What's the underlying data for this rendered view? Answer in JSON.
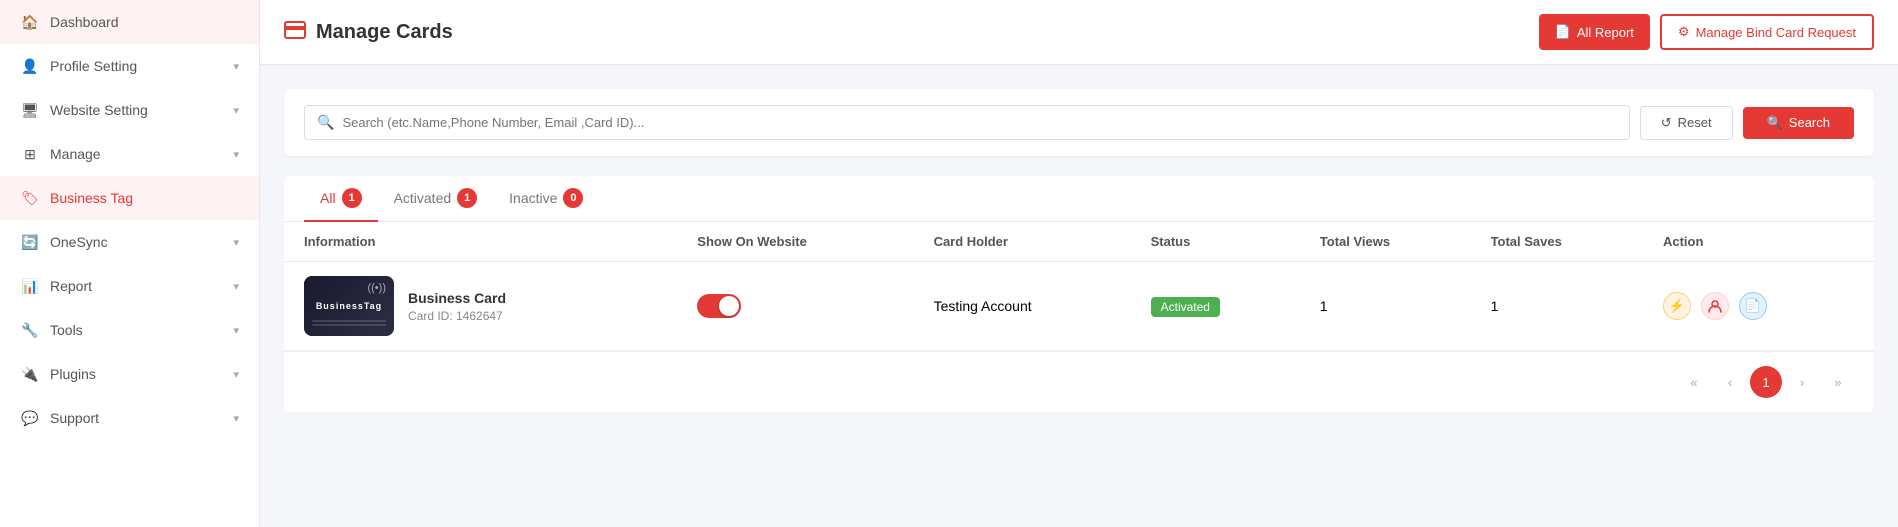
{
  "sidebar": {
    "items": [
      {
        "id": "dashboard",
        "label": "Dashboard",
        "icon": "🏠",
        "hasChevron": false,
        "active": false
      },
      {
        "id": "profile-setting",
        "label": "Profile Setting",
        "icon": "👤",
        "hasChevron": true,
        "active": false
      },
      {
        "id": "website-setting",
        "label": "Website Setting",
        "icon": "🖥",
        "hasChevron": true,
        "active": false
      },
      {
        "id": "manage",
        "label": "Manage",
        "icon": "⊞",
        "hasChevron": true,
        "active": false
      },
      {
        "id": "business-tag",
        "label": "Business Tag",
        "icon": "🏷",
        "hasChevron": false,
        "active": true
      },
      {
        "id": "onesync",
        "label": "OneSync",
        "icon": "🔄",
        "hasChevron": true,
        "active": false
      },
      {
        "id": "report",
        "label": "Report",
        "icon": "📊",
        "hasChevron": true,
        "active": false
      },
      {
        "id": "tools",
        "label": "Tools",
        "icon": "🔧",
        "hasChevron": true,
        "active": false
      },
      {
        "id": "plugins",
        "label": "Plugins",
        "icon": "🔌",
        "hasChevron": true,
        "active": false
      },
      {
        "id": "support",
        "label": "Support",
        "icon": "💬",
        "hasChevron": true,
        "active": false
      }
    ]
  },
  "header": {
    "title": "Manage Cards",
    "title_icon": "🪪",
    "btn_all_report": "All Report",
    "btn_manage_bind": "Manage Bind Card Request"
  },
  "search": {
    "placeholder": "Search (etc.Name,Phone Number, Email ,Card ID)...",
    "reset_label": "Reset",
    "search_label": "Search"
  },
  "tabs": [
    {
      "id": "all",
      "label": "All",
      "count": "1",
      "active": true
    },
    {
      "id": "activated",
      "label": "Activated",
      "count": "1",
      "active": false
    },
    {
      "id": "inactive",
      "label": "Inactive",
      "count": "0",
      "active": false
    }
  ],
  "table": {
    "columns": [
      "Information",
      "Show On Website",
      "Card Holder",
      "Status",
      "Total Views",
      "Total Saves",
      "Action"
    ],
    "rows": [
      {
        "card_name": "Business Card",
        "card_id": "Card ID: 1462647",
        "show_on_website": true,
        "card_holder": "Testing Account",
        "status": "Activated",
        "total_views": "1",
        "total_saves": "1"
      }
    ]
  },
  "pagination": {
    "prev_prev": "«",
    "prev": "‹",
    "current": "1",
    "next": "›",
    "next_next": "»"
  }
}
